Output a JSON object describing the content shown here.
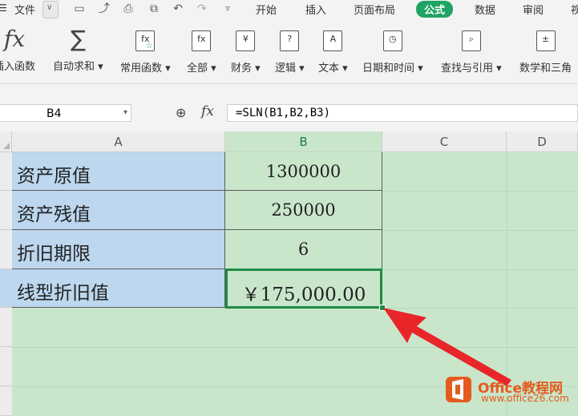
{
  "menu": {
    "file_label": "文件",
    "tabs": [
      "开始",
      "插入",
      "页面布局",
      "公式",
      "数据",
      "审阅",
      "视"
    ],
    "active_tab": "公式"
  },
  "ribbon": {
    "buttons": [
      {
        "label": "插入函数",
        "icon": "fx-icon"
      },
      {
        "label": "自动求和",
        "icon": "sigma-icon",
        "dropdown": true
      },
      {
        "label": "常用函数",
        "icon": "star-function-icon",
        "dropdown": true
      },
      {
        "label": "全部",
        "icon": "all-functions-icon",
        "dropdown": true
      },
      {
        "label": "财务",
        "icon": "yen-book-icon",
        "dropdown": true
      },
      {
        "label": "逻辑",
        "icon": "question-book-icon",
        "dropdown": true
      },
      {
        "label": "文本",
        "icon": "text-book-icon",
        "dropdown": true
      },
      {
        "label": "日期和时间",
        "icon": "clock-book-icon",
        "dropdown": true
      },
      {
        "label": "查找与引用",
        "icon": "search-book-icon",
        "dropdown": true
      },
      {
        "label": "数学和三角",
        "icon": "math-book-icon",
        "dropdown": true
      }
    ]
  },
  "formula_bar": {
    "name_box": "B4",
    "fx_label": "fx",
    "formula": "=SLN(B1,B2,B3)"
  },
  "sheet": {
    "columns": [
      "A",
      "B",
      "C",
      "D"
    ],
    "selected_column": "B",
    "rows": [
      {
        "label": "资产原值",
        "value": "1300000"
      },
      {
        "label": "资产残值",
        "value": "250000"
      },
      {
        "label": "折旧期限",
        "value": "6"
      },
      {
        "label": "线型折旧值",
        "value": "￥175,000.00"
      }
    ]
  },
  "colors": {
    "accent": "#1fa463",
    "sheet_bg": "#c9e6cb",
    "label_bg": "#bcd7ee",
    "arrow": "#e8262a"
  },
  "watermark": {
    "name": "Office教程网",
    "url": "www.office26.com"
  }
}
